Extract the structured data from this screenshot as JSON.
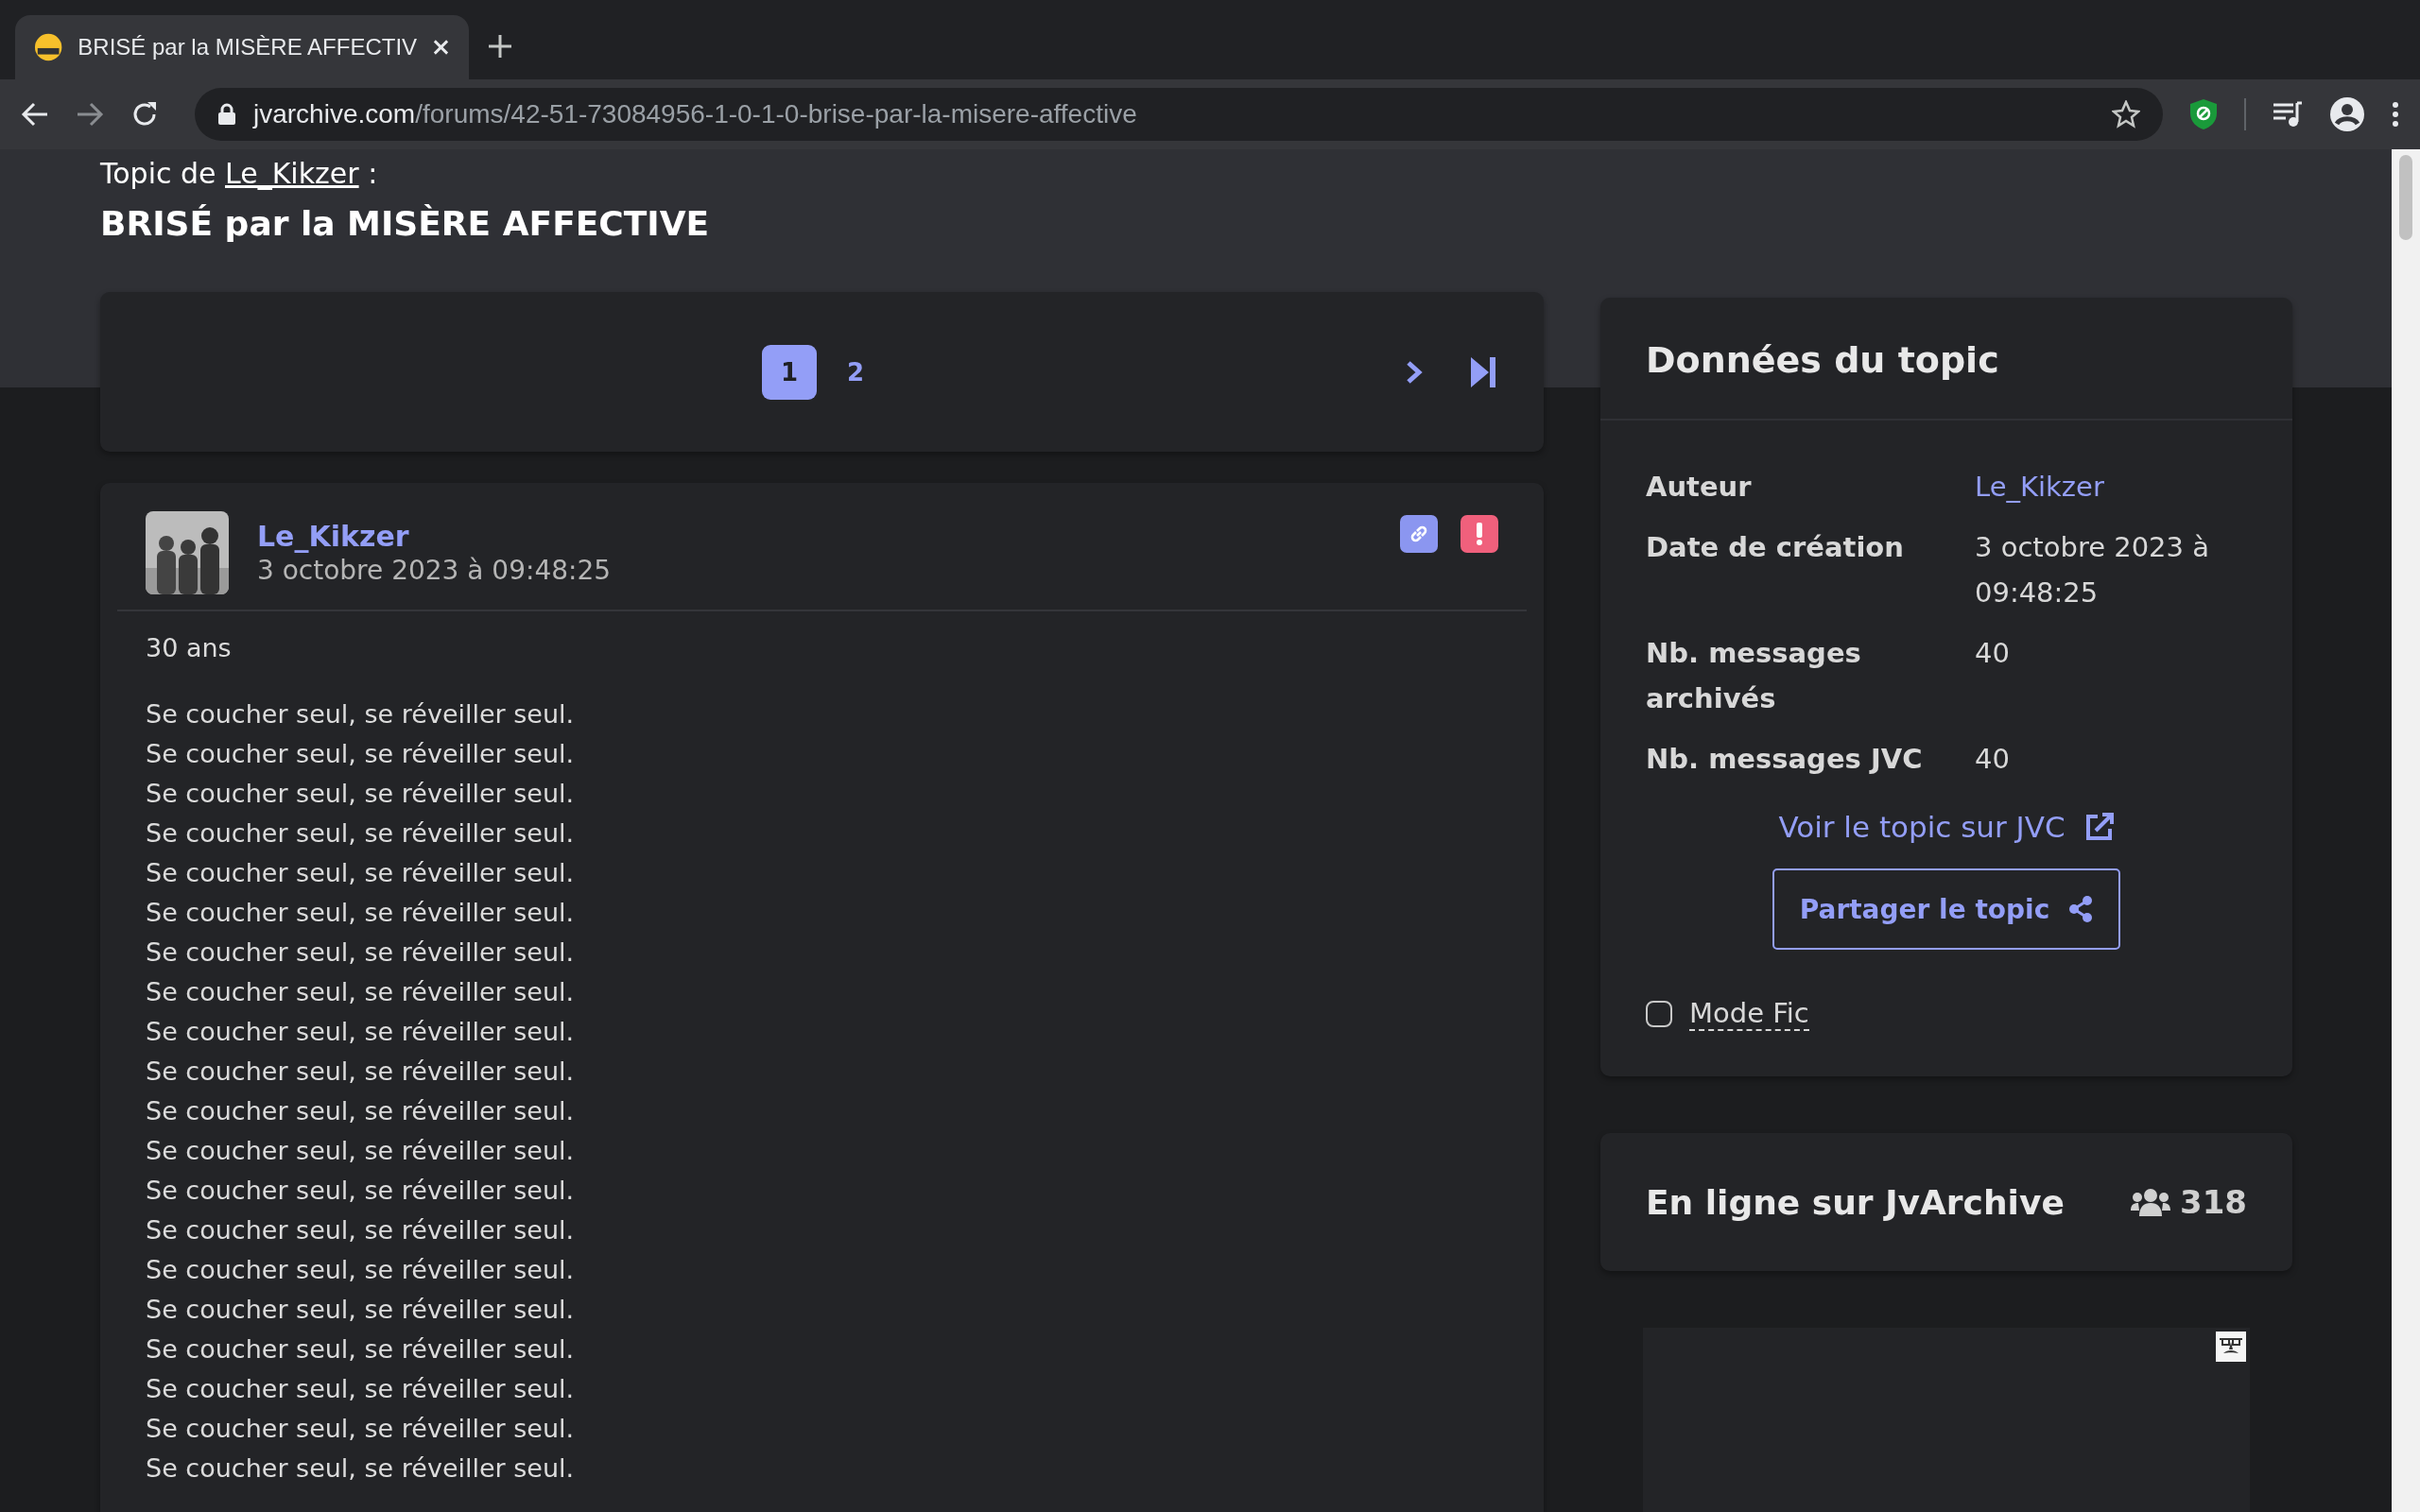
{
  "browser": {
    "tab": {
      "title": "BRISÉ par la MISÈRE AFFECTIV"
    },
    "url_host": "jvarchive.com",
    "url_path": "/forums/42-51-73084956-1-0-1-0-brise-par-la-misere-affective"
  },
  "header": {
    "prefix": "Topic de",
    "author": "Le_Kikzer",
    "suffix": ":",
    "title": "BRISÉ par la MISÈRE AFFECTIVE"
  },
  "pagination": {
    "pages": [
      {
        "label": "1",
        "selected": true
      },
      {
        "label": "2",
        "selected": false
      }
    ]
  },
  "post": {
    "author": "Le_Kikzer",
    "date": "3 octobre 2023 à 09:48:25",
    "intro": "30 ans",
    "lines": [
      "Se coucher seul, se réveiller seul.",
      "Se coucher seul, se réveiller seul.",
      "Se coucher seul, se réveiller seul.",
      "Se coucher seul, se réveiller seul.",
      "Se coucher seul, se réveiller seul.",
      "Se coucher seul, se réveiller seul.",
      "Se coucher seul, se réveiller seul.",
      "Se coucher seul, se réveiller seul.",
      "Se coucher seul, se réveiller seul.",
      "Se coucher seul, se réveiller seul.",
      "Se coucher seul, se réveiller seul.",
      "Se coucher seul, se réveiller seul.",
      "Se coucher seul, se réveiller seul.",
      "Se coucher seul, se réveiller seul.",
      "Se coucher seul, se réveiller seul.",
      "Se coucher seul, se réveiller seul.",
      "Se coucher seul, se réveiller seul.",
      "Se coucher seul, se réveiller seul.",
      "Se coucher seul, se réveiller seul.",
      "Se coucher seul, se réveiller seul."
    ]
  },
  "topic_data": {
    "title": "Données du topic",
    "rows": [
      {
        "label": "Auteur",
        "value": "Le_Kikzer",
        "kind": "link"
      },
      {
        "label": "Date de création",
        "value": "3 octobre 2023 à 09:48:25",
        "kind": "text"
      },
      {
        "label": "Nb. messages archivés",
        "value": "40",
        "kind": "text"
      },
      {
        "label": "Nb. messages JVC",
        "value": "40",
        "kind": "text"
      }
    ],
    "jvc_link": "Voir le topic sur JVC",
    "share_button": "Partager le topic",
    "mode_fic": {
      "label": "Mode Fic",
      "checked": false
    }
  },
  "online": {
    "title": "En ligne sur JvArchive",
    "count": "318"
  }
}
